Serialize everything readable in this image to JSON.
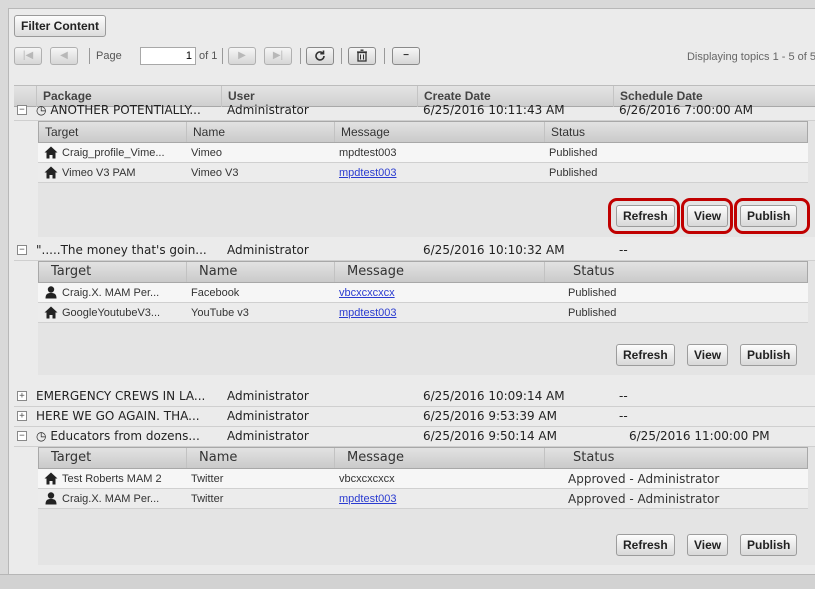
{
  "toolbar": {
    "filter_label": "Filter Content",
    "page_label": "Page",
    "page_value": "1",
    "of_label": "of 1",
    "displaying": "Displaying topics 1 - 5 of 5"
  },
  "columns": {
    "package": "Package",
    "user": "User",
    "create_date": "Create Date",
    "schedule_date": "Schedule Date"
  },
  "sub_columns": {
    "target": "Target",
    "name": "Name",
    "message": "Message",
    "status": "Status"
  },
  "buttons": {
    "refresh": "Refresh",
    "view": "View",
    "publish": "Publish"
  },
  "rows": [
    {
      "expanded": true,
      "scheduled": true,
      "package": "ANOTHER POTENTIALLY...",
      "user": "Administrator",
      "create_date": "6/25/2016 10:11:43 AM",
      "schedule_date": "6/26/2016 7:00:00 AM",
      "targets": [
        {
          "icon": "home-icon",
          "target": "Craig_profile_Vime...",
          "name": "Vimeo",
          "message": "mpdtest003",
          "message_link": false,
          "status": "Published"
        },
        {
          "icon": "home-icon",
          "target": "Vimeo V3 PAM",
          "name": "Vimeo V3",
          "message": "mpdtest003",
          "message_link": true,
          "status": "Published"
        }
      ]
    },
    {
      "expanded": true,
      "scheduled": false,
      "package": "\".....The money that's goin...",
      "user": "Administrator",
      "create_date": "6/25/2016 10:10:32 AM",
      "schedule_date": "--",
      "targets": [
        {
          "icon": "user-icon",
          "target": "Craig.X. MAM Per...",
          "name": "Facebook",
          "message": "vbcxcxcxcx",
          "message_link": true,
          "status": "Published"
        },
        {
          "icon": "home-icon",
          "target": "GoogleYoutubeV3...",
          "name": "YouTube v3",
          "message": "mpdtest003",
          "message_link": true,
          "status": "Published"
        }
      ]
    },
    {
      "expanded": false,
      "package": "EMERGENCY CREWS IN LA...",
      "user": "Administrator",
      "create_date": "6/25/2016 10:09:14 AM",
      "schedule_date": "--"
    },
    {
      "expanded": false,
      "package": "HERE WE GO AGAIN. THA...",
      "user": "Administrator",
      "create_date": "6/25/2016 9:53:39 AM",
      "schedule_date": "--"
    },
    {
      "expanded": true,
      "scheduled": true,
      "package": "Educators from dozens...",
      "user": "Administrator",
      "create_date": "6/25/2016 9:50:14 AM",
      "schedule_date": "6/25/2016 11:00:00 PM",
      "targets": [
        {
          "icon": "home-icon",
          "target": "Test Roberts MAM 2",
          "name": "Twitter",
          "message": "vbcxcxcxcx",
          "message_link": false,
          "status": "Approved - Administrator"
        },
        {
          "icon": "user-icon",
          "target": "Craig.X. MAM Per...",
          "name": "Twitter",
          "message": "mpdtest003",
          "message_link": true,
          "status": "Approved - Administrator"
        }
      ]
    }
  ],
  "colors": {
    "highlight": "#c00000",
    "link": "#2a3bd0"
  }
}
